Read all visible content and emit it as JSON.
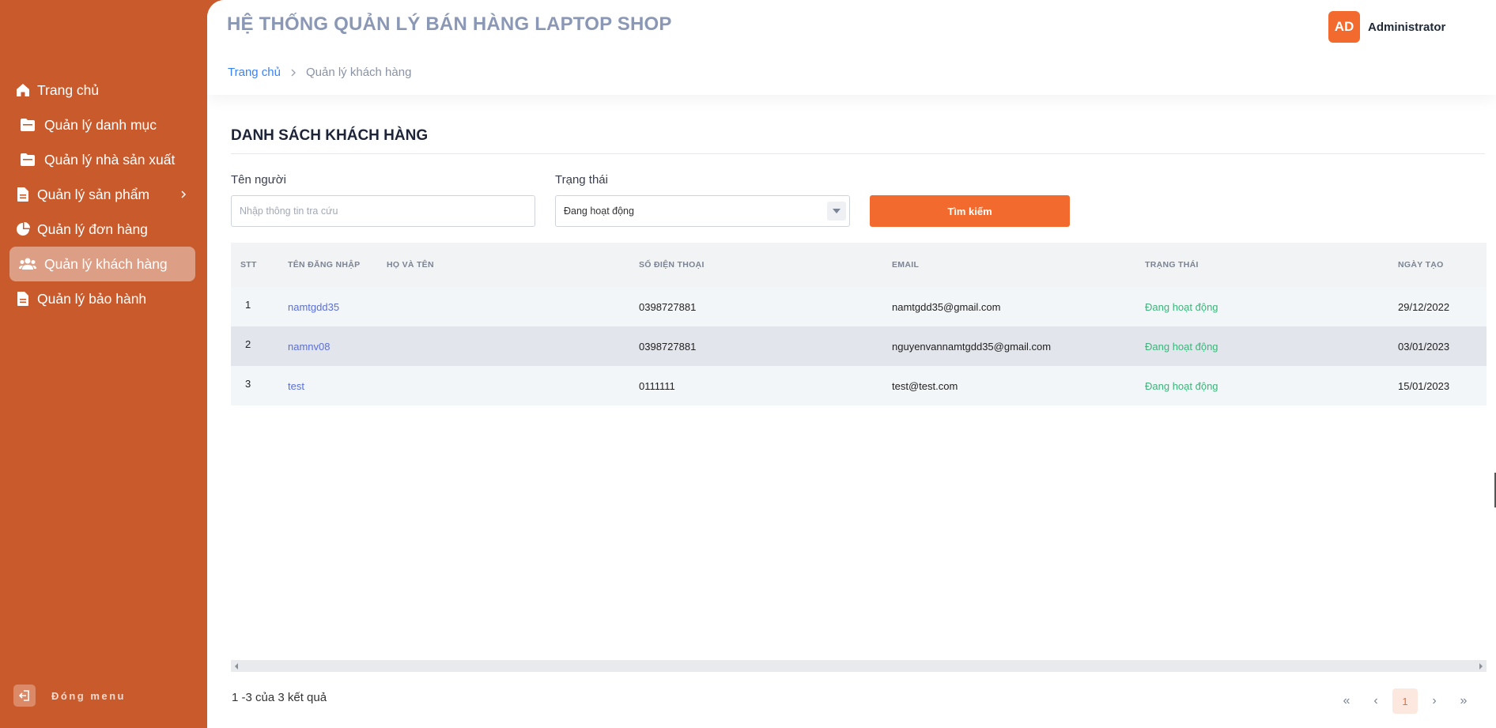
{
  "sidebar": {
    "items": [
      {
        "label": "Trang chủ",
        "icon": "home-icon"
      },
      {
        "label": "Quản lý danh mục",
        "icon": "folder-icon"
      },
      {
        "label": "Quản lý nhà sản xuất",
        "icon": "folder-icon"
      },
      {
        "label": "Quản lý sản phẩm",
        "icon": "document-icon"
      },
      {
        "label": "Quản lý đơn hàng",
        "icon": "pie-chart-icon"
      },
      {
        "label": "Quản lý khách hàng",
        "icon": "users-icon"
      },
      {
        "label": "Quản lý bảo hành",
        "icon": "document-icon"
      }
    ],
    "active_index": 5,
    "close_label": "Đóng menu"
  },
  "header": {
    "title": "HỆ THỐNG QUẢN LÝ BÁN HÀNG LAPTOP SHOP",
    "user": {
      "avatar": "AD",
      "name": "Administrator"
    },
    "breadcrumb": {
      "home": "Trang chủ",
      "current": "Quản lý khách hàng"
    }
  },
  "main": {
    "section_title": "DANH SÁCH KHÁCH HÀNG",
    "filters": {
      "name_label": "Tên người",
      "name_placeholder": "Nhập thông tin tra cứu",
      "status_label": "Trạng thái",
      "status_value": "Đang hoạt động",
      "search_button": "Tìm kiếm"
    },
    "table": {
      "columns": [
        "STT",
        "TÊN ĐĂNG NHẬP",
        "HỌ VÀ TÊN",
        "SỐ ĐIỆN THOẠI",
        "EMAIL",
        "TRẠNG THÁI",
        "NGÀY TẠO"
      ],
      "rows": [
        {
          "stt": "1",
          "username": "namtgdd35",
          "fullname": "",
          "phone": "0398727881",
          "email": "namtgdd35@gmail.com",
          "status": "Đang hoạt động",
          "created": "29/12/2022"
        },
        {
          "stt": "2",
          "username": "namnv08",
          "fullname": "",
          "phone": "0398727881",
          "email": "nguyenvannamtgdd35@gmail.com",
          "status": "Đang hoạt động",
          "created": "03/01/2023"
        },
        {
          "stt": "3",
          "username": "test",
          "fullname": "",
          "phone": "0111111",
          "email": "test@test.com",
          "status": "Đang hoạt động",
          "created": "15/01/2023"
        }
      ]
    },
    "result_text": "1 -3 của 3 kết quả",
    "pagination": {
      "first": "«",
      "prev": "‹",
      "current": "1",
      "next": "›",
      "last": "»"
    }
  },
  "colors": {
    "sidebar": "#c95a2c",
    "accent": "#f26a2e",
    "status_active": "#3bb57a",
    "link": "#3b82f6"
  }
}
